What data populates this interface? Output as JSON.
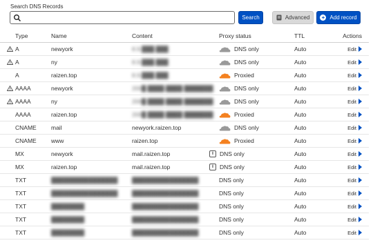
{
  "search": {
    "label": "Search DNS Records",
    "value": "",
    "button_label": "Search"
  },
  "toolbar": {
    "advanced_label": "Advanced",
    "add_record_label": "Add record"
  },
  "columns": {
    "type": "Type",
    "name": "Name",
    "content": "Content",
    "proxy": "Proxy status",
    "ttl": "TTL",
    "actions": "Actions"
  },
  "colors": {
    "accent": "#0051c3",
    "proxied_cloud": "#f48120",
    "dns_only_cloud": "#9a9a9a"
  },
  "rows": [
    {
      "warn": true,
      "type": "A",
      "name": "newyork",
      "content": "8.9.███.███",
      "proxy": "DNS only",
      "proxy_icon": "grey-cloud-icon",
      "ttl": "Auto",
      "edit": "Edit"
    },
    {
      "warn": true,
      "type": "A",
      "name": "ny",
      "content": "8.9.███.███",
      "proxy": "DNS only",
      "proxy_icon": "grey-cloud-icon",
      "ttl": "Auto",
      "edit": "Edit"
    },
    {
      "warn": false,
      "type": "A",
      "name": "raizen.top",
      "content": "8.9.███.███",
      "proxy": "Proxied",
      "proxy_icon": "orange-cloud-icon",
      "ttl": "Auto",
      "edit": "Edit"
    },
    {
      "warn": true,
      "type": "AAAA",
      "name": "newyork",
      "content": "200█:████:████:███████",
      "proxy": "DNS only",
      "proxy_icon": "grey-cloud-icon",
      "ttl": "Auto",
      "edit": "Edit"
    },
    {
      "warn": true,
      "type": "AAAA",
      "name": "ny",
      "content": "200█:████:████:███████",
      "proxy": "DNS only",
      "proxy_icon": "grey-cloud-icon",
      "ttl": "Auto",
      "edit": "Edit"
    },
    {
      "warn": false,
      "type": "AAAA",
      "name": "raizen.top",
      "content": "200█:████:████:███████",
      "proxy": "Proxied",
      "proxy_icon": "orange-cloud-icon",
      "ttl": "Auto",
      "edit": "Edit"
    },
    {
      "warn": false,
      "type": "CNAME",
      "name": "mail",
      "content": "newyork.raizen.top",
      "proxy": "DNS only",
      "proxy_icon": "grey-cloud-icon",
      "ttl": "Auto",
      "edit": "Edit"
    },
    {
      "warn": false,
      "type": "CNAME",
      "name": "www",
      "content": "raizen.top",
      "proxy": "Proxied",
      "proxy_icon": "orange-cloud-icon",
      "ttl": "Auto",
      "edit": "Edit"
    },
    {
      "warn": false,
      "type": "MX",
      "name": "newyork",
      "content": "mail.raizen.top",
      "proxy": "DNS only",
      "proxy_icon": "info-icon",
      "ttl": "Auto",
      "edit": "Edit"
    },
    {
      "warn": false,
      "type": "MX",
      "name": "raizen.top",
      "content": "mail.raizen.top",
      "proxy": "DNS only",
      "proxy_icon": "info-icon",
      "ttl": "Auto",
      "edit": "Edit"
    },
    {
      "warn": false,
      "type": "TXT",
      "name": "████████████████",
      "content": "████████████████",
      "proxy": "DNS only",
      "proxy_icon": "",
      "ttl": "Auto",
      "edit": "Edit"
    },
    {
      "warn": false,
      "type": "TXT",
      "name": "████████████████",
      "content": "████████████████",
      "proxy": "DNS only",
      "proxy_icon": "",
      "ttl": "Auto",
      "edit": "Edit"
    },
    {
      "warn": false,
      "type": "TXT",
      "name": "████████",
      "content": "████████████████",
      "proxy": "DNS only",
      "proxy_icon": "",
      "ttl": "Auto",
      "edit": "Edit"
    },
    {
      "warn": false,
      "type": "TXT",
      "name": "████████",
      "content": "████████████████",
      "proxy": "DNS only",
      "proxy_icon": "",
      "ttl": "Auto",
      "edit": "Edit"
    },
    {
      "warn": false,
      "type": "TXT",
      "name": "████████",
      "content": "████████████████",
      "proxy": "DNS only",
      "proxy_icon": "",
      "ttl": "Auto",
      "edit": "Edit"
    }
  ]
}
